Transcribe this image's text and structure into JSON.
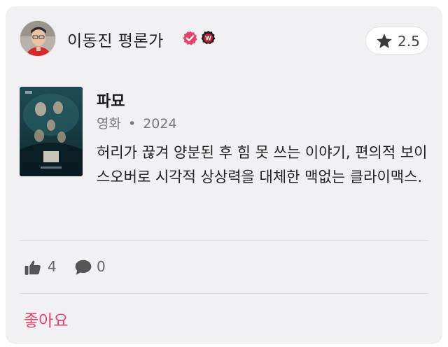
{
  "author": {
    "name": "이동진 평론가",
    "verified_icon": "verified-check-icon",
    "badge_icon": "w-badge-icon",
    "badge_letter": "W"
  },
  "rating": {
    "icon": "star-icon",
    "value": "2.5"
  },
  "movie": {
    "title": "파묘",
    "category": "영화",
    "separator": "•",
    "year": "2024"
  },
  "review": {
    "text": "허리가 끊겨 양분된 후 힘 못 쓰는 이야기, 편의적 보이스오버로 시각적 상상력을 대체한 맥없는 클라이맥스."
  },
  "stats": {
    "like_icon": "thumbs-up-icon",
    "likes": "4",
    "comment_icon": "comment-icon",
    "comments": "0"
  },
  "actions": {
    "like_label": "좋아요"
  },
  "colors": {
    "accent": "#e9426d",
    "card_bg": "#f1f1f3",
    "badge_red": "#c01c2c"
  }
}
